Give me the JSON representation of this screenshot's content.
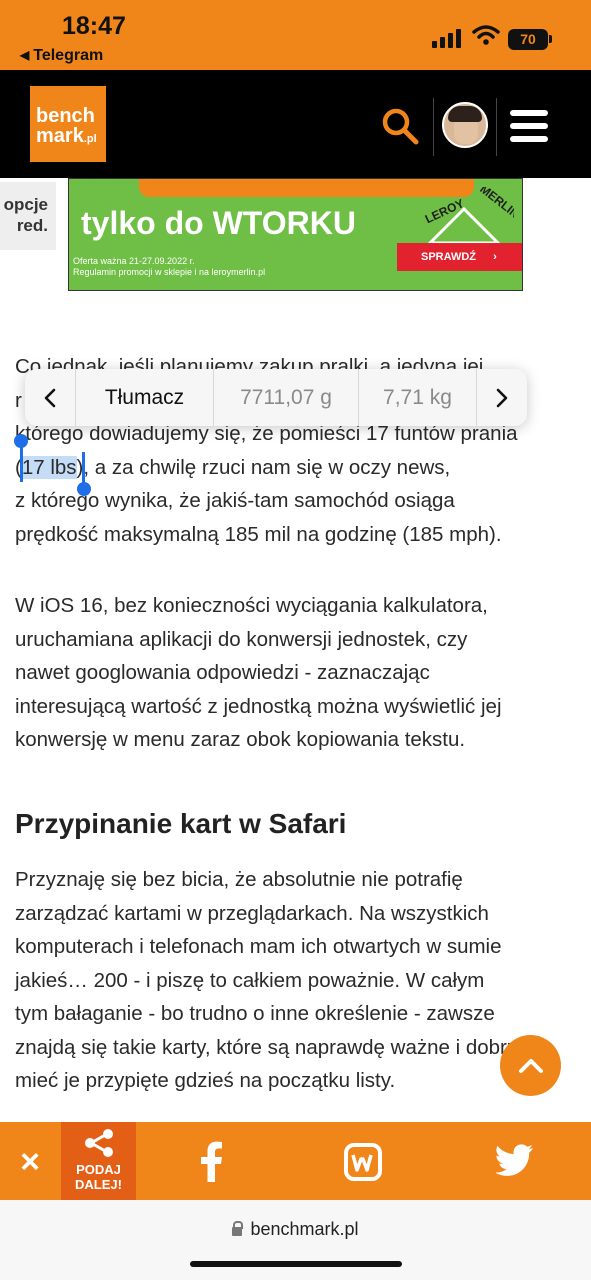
{
  "status_bar": {
    "time": "18:47",
    "back_app": "Telegram",
    "battery": "70"
  },
  "header": {
    "logo_line1": "bench",
    "logo_line2": "mark",
    "logo_tld": ".pl",
    "icons": [
      "search-icon",
      "avatar",
      "hamburger-menu-icon"
    ]
  },
  "ad": {
    "side_tab": [
      "opcje",
      "red."
    ],
    "headline": "tylko do WTORKU",
    "fine_print_1": "Oferta ważna 21-27.09.2022 r.",
    "fine_print_2": "Regulamin promocji w sklepie i na leroymerlin.pl",
    "brand_line1": "LEROY",
    "brand_line2": "MERLIN",
    "cta": "SPRAWDŹ"
  },
  "article": {
    "p1_line1": "Co jednak, jeśli planujemy zakup pralki, a jedyna jej",
    "p1_line2_start": "r",
    "p1_line3": "którego dowiadujemy się, że pomieści 17 funtów prania",
    "p1_line4_open": "(",
    "p1_selected": "17 lbs",
    "p1_line4_rest": "), a za chwilę rzuci nam się w oczy news,",
    "p1_line5": "z którego wynika, że jakiś-tam samochód osiąga",
    "p1_line6": "prędkość maksymalną 185 mil na godzinę (185 mph).",
    "p2_lines": [
      "W iOS 16, bez konieczności wyciągania kalkulatora,",
      "uruchamiana aplikacji do konwersji jednostek, czy",
      "nawet googlowania odpowiedzi - zaznaczając",
      "interesującą wartość z jednostką można wyświetlić jej",
      "konwersję w menu zaraz obok kopiowania tekstu."
    ],
    "heading": "Przypinanie kart w Safari",
    "p3_lines": [
      "Przyznaję się bez bicia, że absolutnie nie potrafię",
      "zarządzać kartami w przeglądarkach. Na wszystkich",
      "komputerach i telefonach mam ich otwartych w sumie",
      "jakieś… 200 - i piszę to całkiem poważnie. W całym",
      "tym bałaganie - bo trudno o inne określenie - zawsze",
      "znajdą się takie karty, które są naprawdę ważne i dobrze",
      "mieć je przypięte gdzieś na początku listy."
    ]
  },
  "context_menu": {
    "prev": "<",
    "translate": "Tłumacz",
    "conv_grams": "7711,07 g",
    "conv_kg": "7,71 kg",
    "next": ">"
  },
  "share_bar": {
    "close": "×",
    "share_line1": "PODAJ",
    "share_line2": "DALEJ!",
    "icons": [
      "facebook-icon",
      "wykop-icon",
      "twitter-icon"
    ]
  },
  "safari": {
    "url": "benchmark.pl"
  },
  "colors": {
    "brand_orange": "#f08519",
    "share_dark_orange": "#e35f16",
    "selection": "#c5dcf6",
    "handle_blue": "#1e6ee8",
    "ad_green": "#6fbe45",
    "ad_red": "#e2232f"
  }
}
